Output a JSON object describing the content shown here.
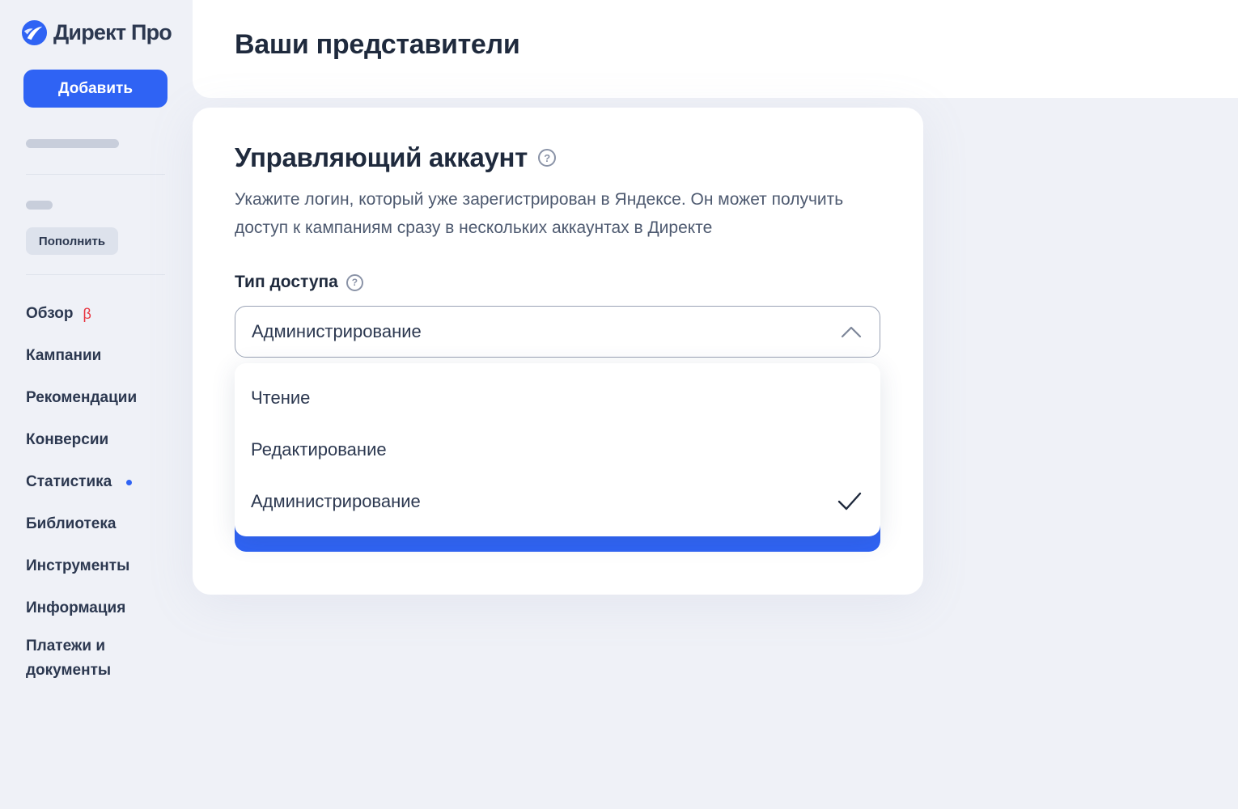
{
  "brand": {
    "name": "Директ Про",
    "icon": "yandex-direct-logo-icon",
    "color": "#2f63f4"
  },
  "sidebar": {
    "add_label": "Добавить",
    "topup_label": "Пополнить",
    "nav": [
      {
        "label": "Обзор",
        "badge": "β"
      },
      {
        "label": "Кампании"
      },
      {
        "label": "Рекомендации"
      },
      {
        "label": "Конверсии"
      },
      {
        "label": "Статистика",
        "indicator": "blue-dot"
      },
      {
        "label": "Библиотека"
      },
      {
        "label": "Инструменты"
      },
      {
        "label": "Информация"
      },
      {
        "label": "Платежи и документы"
      }
    ]
  },
  "header": {
    "title": "Ваши представители"
  },
  "card": {
    "title": "Управляющий аккаунт",
    "title_help_icon": "question-circle-icon",
    "description": "Укажите логин, который уже зарегистрирован в Яндексе. Он может получить доступ к кампаниям сразу в нескольких аккаунтах в Директе",
    "field_label": "Тип доступа",
    "select": {
      "value": "Администрирование",
      "icon": "chevron-up-icon",
      "expanded": true,
      "options": [
        {
          "label": "Чтение",
          "selected": false
        },
        {
          "label": "Редактирование",
          "selected": false
        },
        {
          "label": "Администрирование",
          "selected": true
        }
      ]
    }
  },
  "colors": {
    "accent": "#2f63f4",
    "beta": "#e8343f",
    "background": "#eff1f7"
  }
}
